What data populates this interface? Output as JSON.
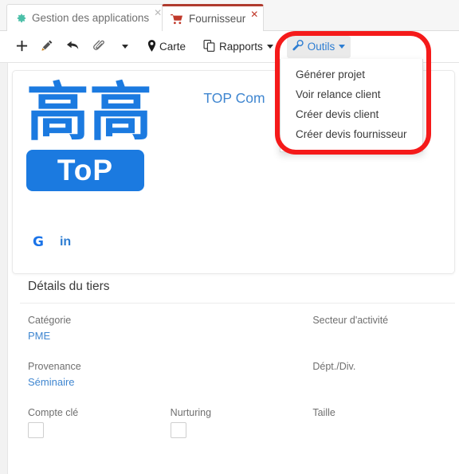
{
  "window": {
    "tabs": [
      {
        "label": "Gestion des applications",
        "icon": "gear-icon",
        "active": false,
        "close": "✕"
      },
      {
        "label": "Fournisseur",
        "icon": "shopping-cart-icon",
        "active": true,
        "close": "✕"
      }
    ]
  },
  "toolbar": {
    "buttons": [
      {
        "name": "add-button",
        "icon": "plus-icon",
        "label": ""
      },
      {
        "name": "edit-button",
        "icon": "pencil-icon",
        "label": ""
      },
      {
        "name": "reply-button",
        "icon": "reply-arrow-icon",
        "label": ""
      },
      {
        "name": "attach-button",
        "icon": "paperclip-icon",
        "label": ""
      },
      {
        "name": "more-button",
        "icon": "caret-down-icon",
        "label": ""
      }
    ],
    "carte_label": "Carte",
    "rapports_label": "Rapports",
    "outils_label": "Outils"
  },
  "outils_menu": {
    "items": [
      "Générer projet",
      "Voir relance client",
      "Créer devis client",
      "Créer devis fournisseur"
    ]
  },
  "annotation": {
    "type": "rounded-rectangle-highlight",
    "color": "#f51a1a"
  },
  "card": {
    "logo": {
      "cjk_text": "高高",
      "badge_text": "ToP",
      "color": "#1b7ae0"
    },
    "company_name": "TOP Com",
    "socials": [
      {
        "name": "google-icon",
        "glyph": "G",
        "color": "#1a73e8"
      },
      {
        "name": "linkedin-icon",
        "glyph": "in",
        "color": "#2d7dd2"
      }
    ]
  },
  "details": {
    "title": "Détails du tiers",
    "rows": [
      [
        {
          "label": "Catégorie",
          "value": "PME",
          "type": "link"
        },
        {
          "label": "",
          "value": "",
          "type": "blank"
        },
        {
          "label": "Secteur d'activité",
          "value": "",
          "type": "link"
        }
      ],
      [
        {
          "label": "Provenance",
          "value": "Séminaire",
          "type": "link"
        },
        {
          "label": "",
          "value": "",
          "type": "blank"
        },
        {
          "label": "Dépt./Div.",
          "value": "",
          "type": "link"
        }
      ],
      [
        {
          "label": "Compte clé",
          "value": "",
          "type": "checkbox"
        },
        {
          "label": "Nurturing",
          "value": "",
          "type": "checkbox"
        },
        {
          "label": "Taille",
          "value": "",
          "type": "link"
        }
      ]
    ]
  },
  "colors": {
    "accent_blue": "#3f86d0",
    "tab_active_red": "#b03b2e",
    "annotation_red": "#f51a1a",
    "logo_blue": "#1b7ae0"
  }
}
